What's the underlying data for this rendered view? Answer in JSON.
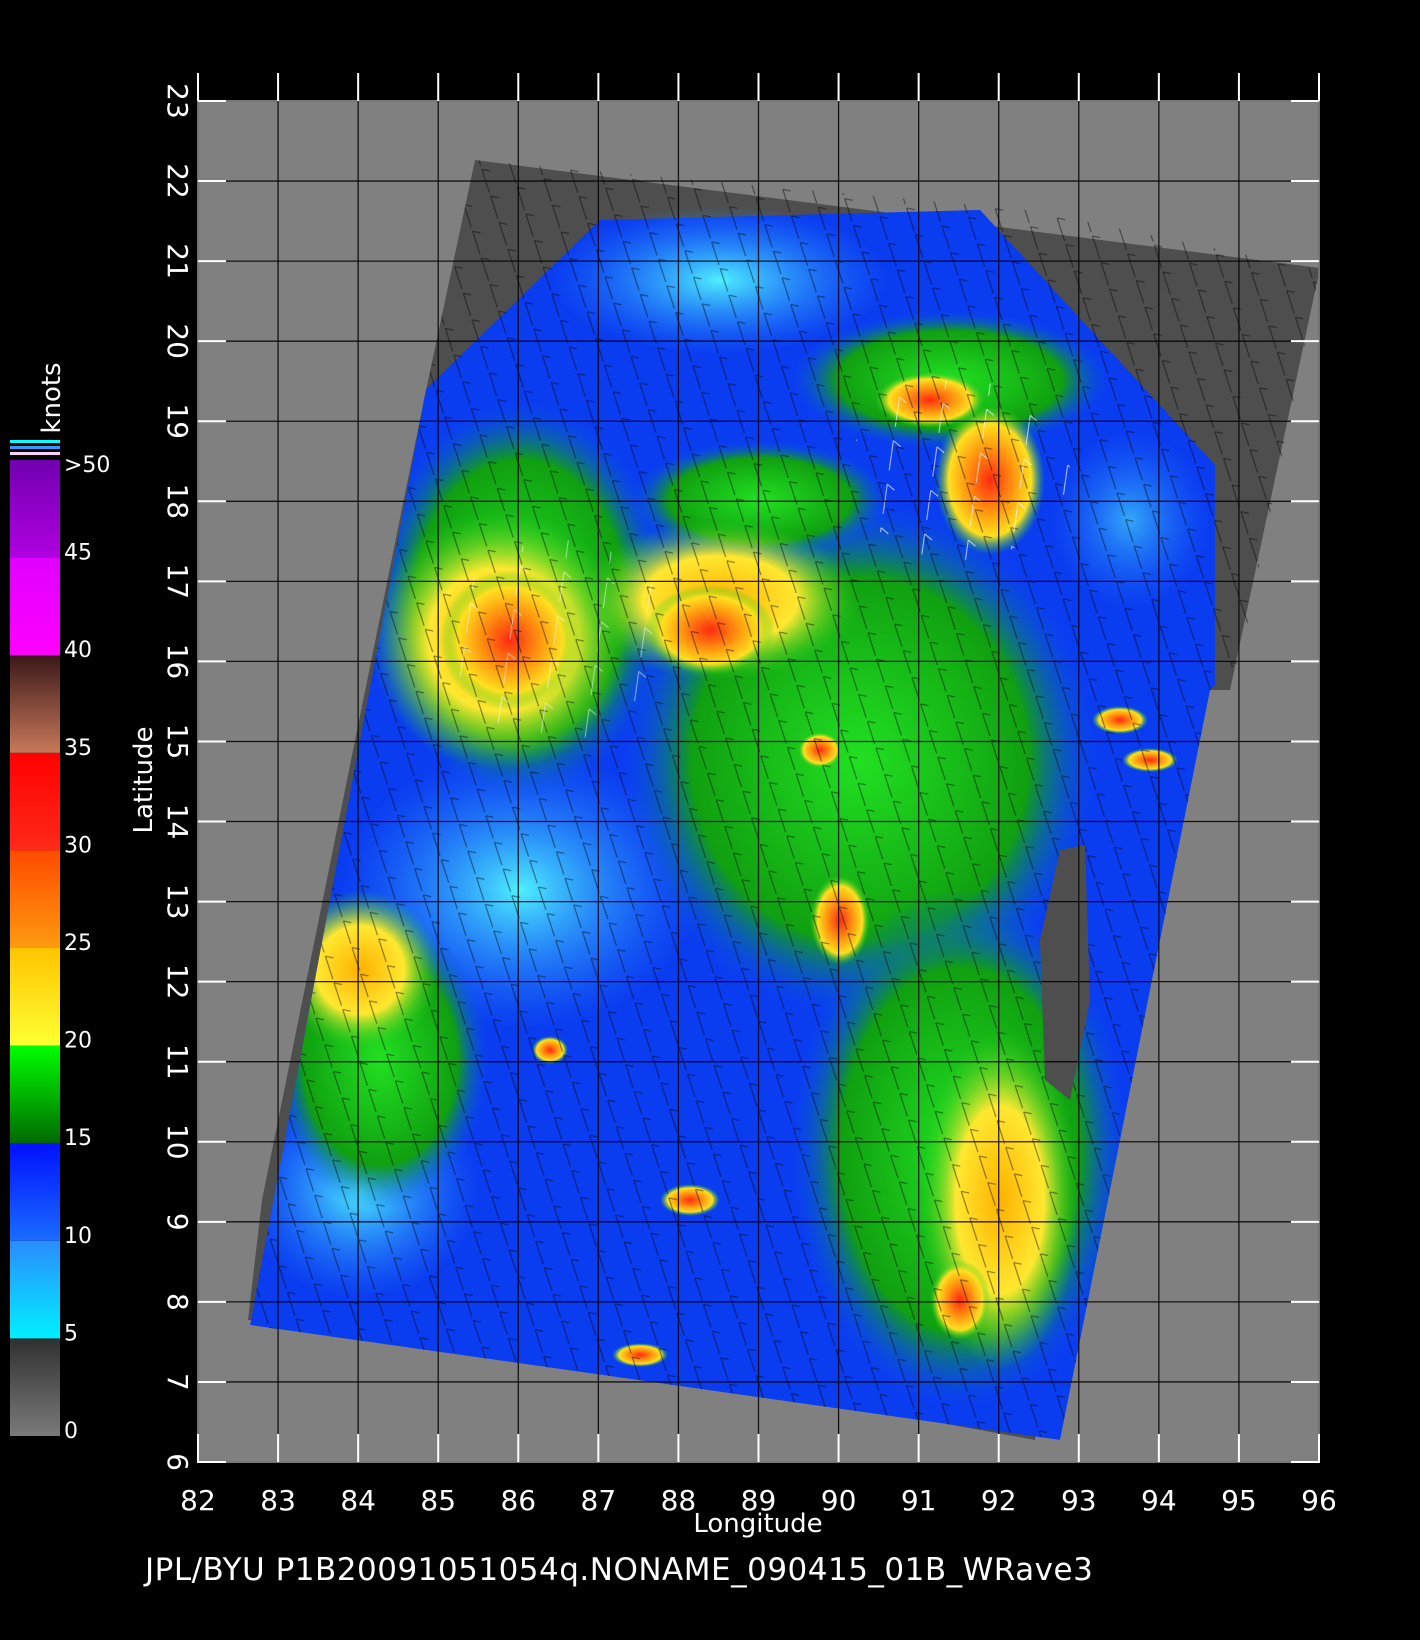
{
  "colorbar": {
    "title": "knots",
    "labels": [
      ">50",
      "45",
      "40",
      "35",
      "30",
      "25",
      "20",
      "15",
      "10",
      "5",
      "0"
    ],
    "bands": [
      {
        "from": 0,
        "to": 5,
        "colors": [
          "#7a7a7a",
          "#303030"
        ]
      },
      {
        "from": 5,
        "to": 10,
        "colors": [
          "#00f0ff",
          "#2a8cff"
        ]
      },
      {
        "from": 10,
        "to": 15,
        "colors": [
          "#1a6cff",
          "#0010ff"
        ]
      },
      {
        "from": 15,
        "to": 20,
        "colors": [
          "#006a00",
          "#00ff00"
        ]
      },
      {
        "from": 20,
        "to": 25,
        "colors": [
          "#ffff33",
          "#ffc400"
        ]
      },
      {
        "from": 25,
        "to": 30,
        "colors": [
          "#ff9a10",
          "#ff4a00"
        ]
      },
      {
        "from": 30,
        "to": 35,
        "colors": [
          "#ff2a1a",
          "#ff0000"
        ]
      },
      {
        "from": 35,
        "to": 40,
        "colors": [
          "#c8785a",
          "#3a1818"
        ]
      },
      {
        "from": 40,
        "to": 45,
        "colors": [
          "#ff00ff",
          "#e000ff"
        ]
      },
      {
        "from": 45,
        "to": 50,
        "colors": [
          "#b000e0",
          "#7000b0"
        ]
      }
    ]
  },
  "map": {
    "x_axis_label": "Longitude",
    "y_axis_label": "Latitude",
    "lon_range": [
      82,
      96
    ],
    "lat_range": [
      6,
      23
    ],
    "lon_ticks": [
      "82",
      "83",
      "84",
      "85",
      "86",
      "87",
      "88",
      "89",
      "90",
      "91",
      "92",
      "93",
      "94",
      "95",
      "96"
    ],
    "lat_ticks": [
      "6",
      "7",
      "8",
      "9",
      "10",
      "11",
      "12",
      "13",
      "14",
      "15",
      "16",
      "17",
      "18",
      "19",
      "20",
      "21",
      "22",
      "23"
    ],
    "grid": true,
    "background_color": "#808080",
    "swath_color": "#505050",
    "wind_regions": [
      {
        "lon": 85.9,
        "lat": 16.1,
        "speed": 31
      },
      {
        "lon": 88.4,
        "lat": 16.2,
        "speed": 33
      },
      {
        "lon": 91.9,
        "lat": 18.2,
        "speed": 32
      },
      {
        "lon": 91.2,
        "lat": 19.3,
        "speed": 30
      },
      {
        "lon": 83.6,
        "lat": 11.9,
        "speed": 27
      },
      {
        "lon": 86.2,
        "lat": 13.2,
        "speed": 7
      },
      {
        "lon": 90.0,
        "lat": 12.5,
        "speed": 30
      }
    ]
  },
  "footer": {
    "text": "JPL/BYU  P1B20091051054q.NONAME_090415_01B_WRave3"
  }
}
